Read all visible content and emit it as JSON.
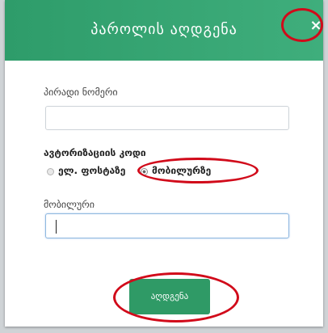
{
  "modal": {
    "title": "პაროლის აღდგენა",
    "close_glyph": "×"
  },
  "form": {
    "personal_number_label": "პირადი ნომერი",
    "personal_number_value": "",
    "auth_code_label": "ავტორიზაციის კოდი",
    "radio_options": [
      {
        "label": "ელ. ფოსტაზე",
        "checked": false
      },
      {
        "label": "მობილურზე",
        "checked": true
      }
    ],
    "mobile_label": "მობილური",
    "mobile_value": "",
    "submit_label": "აღდგენა"
  },
  "colors": {
    "header_green": "#3fae7c",
    "button_green": "#2f9a66",
    "annotation_red": "#d10a1a"
  }
}
